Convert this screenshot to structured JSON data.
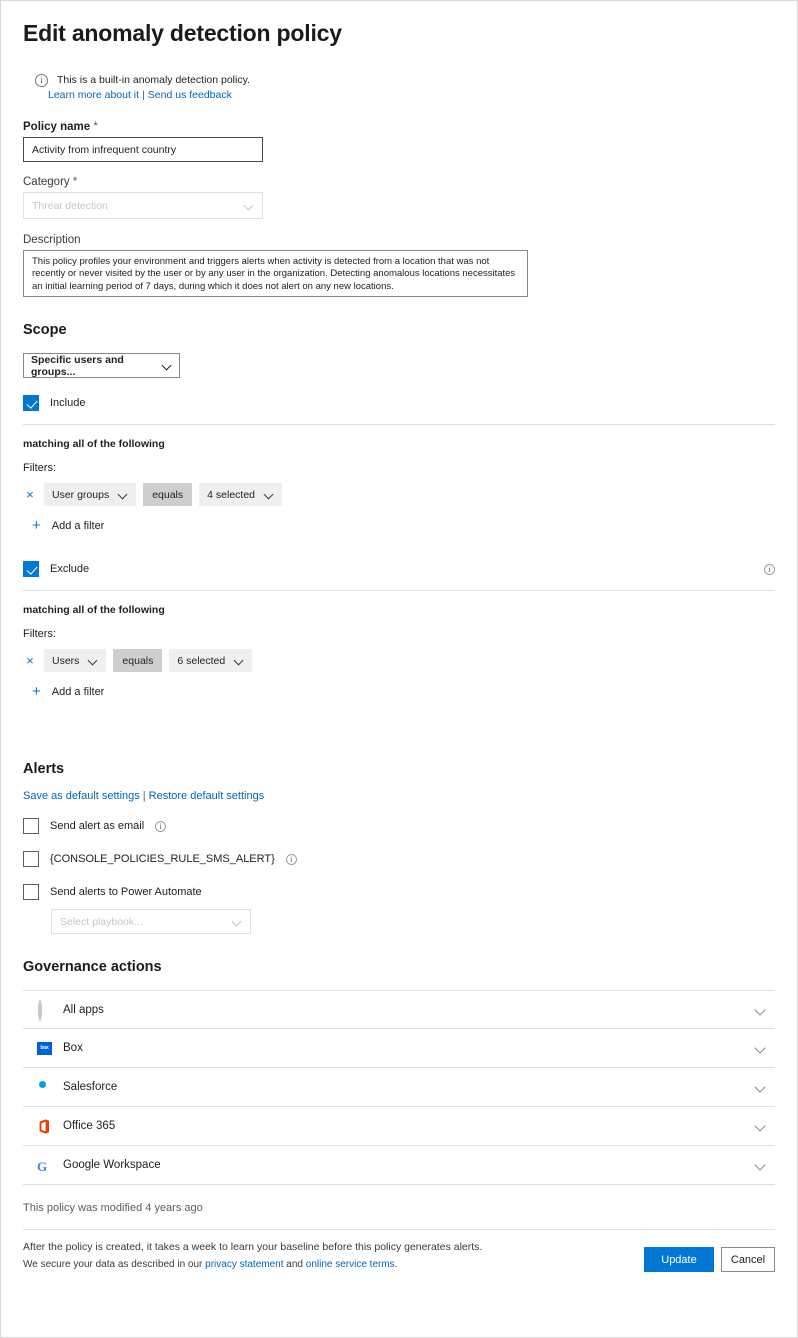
{
  "header": {
    "title": "Edit anomaly detection policy",
    "info_icon": "info-icon",
    "info_text": "This is a built-in anomaly detection policy.",
    "learn_more_link": "Learn more about it",
    "separator": "|",
    "feedback_link": "Send us feedback"
  },
  "form": {
    "policy_name_label": "Policy name",
    "required_mark": "*",
    "policy_name_value": "Activity from infrequent country",
    "category_label": "Category",
    "category_value": "Threat detection",
    "description_label": "Description",
    "description_value": "This policy profiles your environment and triggers alerts when activity is detected from a location that was not recently or never visited by the user or by any user in the organization. Detecting anomalous locations necessitates an initial learning period of 7 days, during which it does not alert on any new locations."
  },
  "scope": {
    "title": "Scope",
    "scope_select_value": "Specific users and groups...",
    "include": {
      "label": "Include",
      "checked": true,
      "matching_text": "matching all of the following",
      "filters_label": "Filters:",
      "filters": [
        {
          "remove": "×",
          "field": "User groups",
          "operator": "equals",
          "value": "4 selected"
        }
      ],
      "add_filter_label": "Add a filter",
      "add_filter_icon": "plus-icon"
    },
    "exclude": {
      "label": "Exclude",
      "checked": true,
      "info_icon": "info-icon",
      "matching_text": "matching all of the following",
      "filters_label": "Filters:",
      "filters": [
        {
          "remove": "×",
          "field": "Users",
          "operator": "equals",
          "value": "6 selected"
        }
      ],
      "add_filter_label": "Add a filter",
      "add_filter_icon": "plus-icon"
    }
  },
  "alerts": {
    "title": "Alerts",
    "save_default_link": "Save as default settings",
    "separator": "|",
    "restore_default_link": "Restore default settings",
    "options": [
      {
        "label": "Send alert as email",
        "checked": false,
        "has_info": true
      },
      {
        "label": "{CONSOLE_POLICIES_RULE_SMS_ALERT}",
        "checked": false,
        "has_info": true
      },
      {
        "label": "Send alerts to Power Automate",
        "checked": false,
        "has_info": false
      }
    ],
    "playbook_placeholder": "Select playbook..."
  },
  "governance": {
    "title": "Governance actions",
    "rows": [
      {
        "label": "All apps",
        "icon": "all-apps-icon"
      },
      {
        "label": "Box",
        "icon": "box-icon",
        "icon_text": "box"
      },
      {
        "label": "Salesforce",
        "icon": "salesforce-icon"
      },
      {
        "label": "Office 365",
        "icon": "office365-icon"
      },
      {
        "label": "Google Workspace",
        "icon": "google-workspace-icon",
        "icon_text": "G"
      }
    ]
  },
  "footer": {
    "modified_text": "This policy was modified 4 years ago",
    "legal_line1": "After the policy is created, it takes a week to learn your baseline before this policy generates alerts.",
    "legal_line2_prefix": "We secure your data as described in our ",
    "privacy_link": "privacy statement",
    "legal_line2_mid": " and ",
    "terms_link": "online service terms",
    "legal_line2_suffix": ".",
    "update_button": "Update",
    "cancel_button": "Cancel"
  },
  "colors": {
    "accent": "#0078d4",
    "link": "#0067b8",
    "chip_bg": "#efefef",
    "chip_op_bg": "#cfcfcf"
  }
}
